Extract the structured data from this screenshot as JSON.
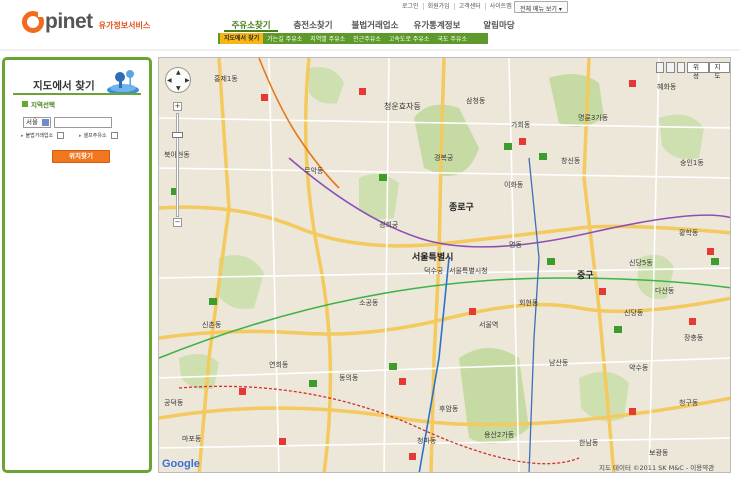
{
  "header": {
    "logo_text": "pinet",
    "logo_sub": "유가정보서비스",
    "util_links": [
      "로그인",
      "회원가입",
      "고객센터",
      "사이트맵"
    ],
    "menu_all_label": "전체 메뉴 보기",
    "gnb": [
      "주유소찾기",
      "충전소찾기",
      "불법거래업소",
      "유가통계정보",
      "알림마당"
    ],
    "subnav": [
      "지도에서 찾기",
      "가는길 주유소",
      "지역별 주유소",
      "인근주유소",
      "고속도로 주유소",
      "국도 주유소"
    ]
  },
  "sidebar": {
    "title": "지도에서 찾기",
    "section_label": "지역선택",
    "region_select": "서울",
    "region_input_placeholder": "",
    "check_illegal_label": "불법거래업소",
    "check_self_label": "셀프주유소",
    "search_button": "위치찾기"
  },
  "map": {
    "type_map": "지도",
    "type_sat": "위성",
    "google": "Google",
    "copyright": "지도 데이터 ©2011 SK M&C - 이용약관",
    "labels": {
      "l_hyehwa": "혜화동",
      "l_hongje1": "홍제1동",
      "l_bukahyeon": "북아현동",
      "l_yeonhui": "연희동",
      "l_sinchon": "신촌동",
      "l_muak": "무악동",
      "l_sajik": "사직동",
      "l_jongno": "종로구",
      "l_cheongun": "청운효자동",
      "l_samcheong": "삼청동",
      "l_seoul": "서울특별시",
      "l_junggu": "중구",
      "l_myeongdong": "명동",
      "l_sogong": "소공동",
      "l_hoehyeon": "회현동",
      "l_yongsan": "용산2가동",
      "l_huam": "후암동",
      "l_cheongpa": "청파동",
      "l_gongdeok": "공덕동",
      "l_mapo": "마포동",
      "l_sindang": "신당동",
      "l_jangchung": "장충동",
      "l_ihwa": "이화동",
      "l_changsin": "창신동",
      "l_sungin": "숭인1동",
      "l_myeongnyun": "명륜3가동",
      "l_gahoe": "가회동",
      "l_hwanghak": "황학동",
      "l_dasan": "다산동",
      "l_yaksu": "약수동",
      "l_cheonggu": "청구동",
      "l_seoul_station": "서울역",
      "l_namsan": "남산동",
      "l_sindang5": "신당5동",
      "l_dongui": "동의동",
      "l_gyeonghui": "경희궁",
      "l_deoksu": "덕수궁",
      "l_gyeongbok": "경복궁",
      "l_cityhall": "서울특별시청",
      "l_hannam": "한남동",
      "l_bogwang": "보광동"
    }
  }
}
